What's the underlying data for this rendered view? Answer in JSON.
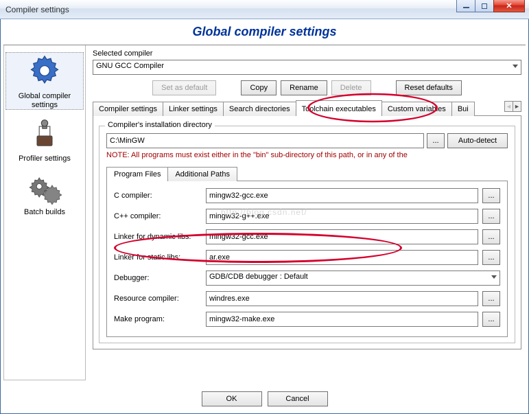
{
  "window": {
    "title": "Compiler settings"
  },
  "header": {
    "title": "Global compiler settings"
  },
  "sidebar": {
    "items": [
      {
        "label": "Global compiler\nsettings"
      },
      {
        "label": "Profiler settings"
      },
      {
        "label": "Batch builds"
      }
    ]
  },
  "main": {
    "selected_compiler_label": "Selected compiler",
    "selected_compiler_value": "GNU GCC Compiler",
    "buttons": {
      "set_default": "Set as default",
      "copy": "Copy",
      "rename": "Rename",
      "delete": "Delete",
      "reset": "Reset defaults"
    },
    "tabs": {
      "compiler_settings": "Compiler settings",
      "linker_settings": "Linker settings",
      "search_directories": "Search directories",
      "toolchain_executables": "Toolchain executables",
      "custom_variables": "Custom variables",
      "build": "Bui"
    },
    "install": {
      "group_title": "Compiler's installation directory",
      "path": "C:\\MinGW",
      "autodetect": "Auto-detect",
      "note": "NOTE: All programs must exist either in the \"bin\" sub-directory of this path, or in any of the"
    },
    "subtabs": {
      "program_files": "Program Files",
      "additional_paths": "Additional Paths"
    },
    "fields": {
      "c_compiler": {
        "label": "C compiler:",
        "value": "mingw32-gcc.exe"
      },
      "cpp_compiler": {
        "label": "C++ compiler:",
        "value": "mingw32-g++.exe"
      },
      "linker_dynamic": {
        "label": "Linker for dynamic libs:",
        "value": "mingw32-gcc.exe"
      },
      "linker_static": {
        "label": "Linker for static libs:",
        "value": "ar.exe"
      },
      "debugger": {
        "label": "Debugger:",
        "value": "GDB/CDB debugger : Default"
      },
      "resource_compiler": {
        "label": "Resource compiler:",
        "value": "windres.exe"
      },
      "make_program": {
        "label": "Make program:",
        "value": "mingw32-make.exe"
      }
    }
  },
  "dialog": {
    "ok": "OK",
    "cancel": "Cancel"
  },
  "watermark": "http://blog.csdn.net/"
}
